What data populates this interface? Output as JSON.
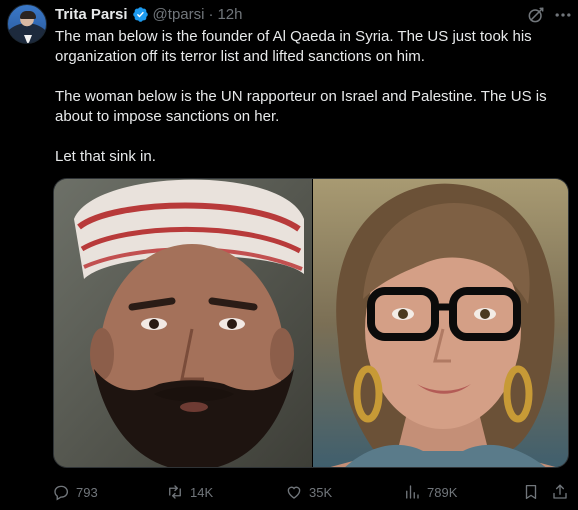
{
  "author": {
    "name": "Trita Parsi",
    "handle": "@tparsi",
    "separator": "·",
    "time": "12h"
  },
  "tweet": {
    "paragraphs": [
      "The man below is the founder of Al Qaeda in Syria. The US just took his organization off its terror list and lifted sanctions on him.",
      "The woman below is the UN rapporteur on Israel and Palestine. The US is about to impose sanctions on her.",
      "Let that sink in."
    ]
  },
  "media": {
    "images": [
      "man-portrait",
      "woman-portrait"
    ]
  },
  "actions": {
    "replies": "793",
    "reposts": "14K",
    "likes": "35K",
    "views": "789K"
  },
  "colors": {
    "background": "#000000",
    "text": "#e7e9ea",
    "muted": "#71767b",
    "verified": "#1d9bf0"
  },
  "icons": [
    "grok-icon",
    "more-icon",
    "reply-icon",
    "repost-icon",
    "like-icon",
    "views-icon",
    "bookmark-icon",
    "share-icon"
  ]
}
